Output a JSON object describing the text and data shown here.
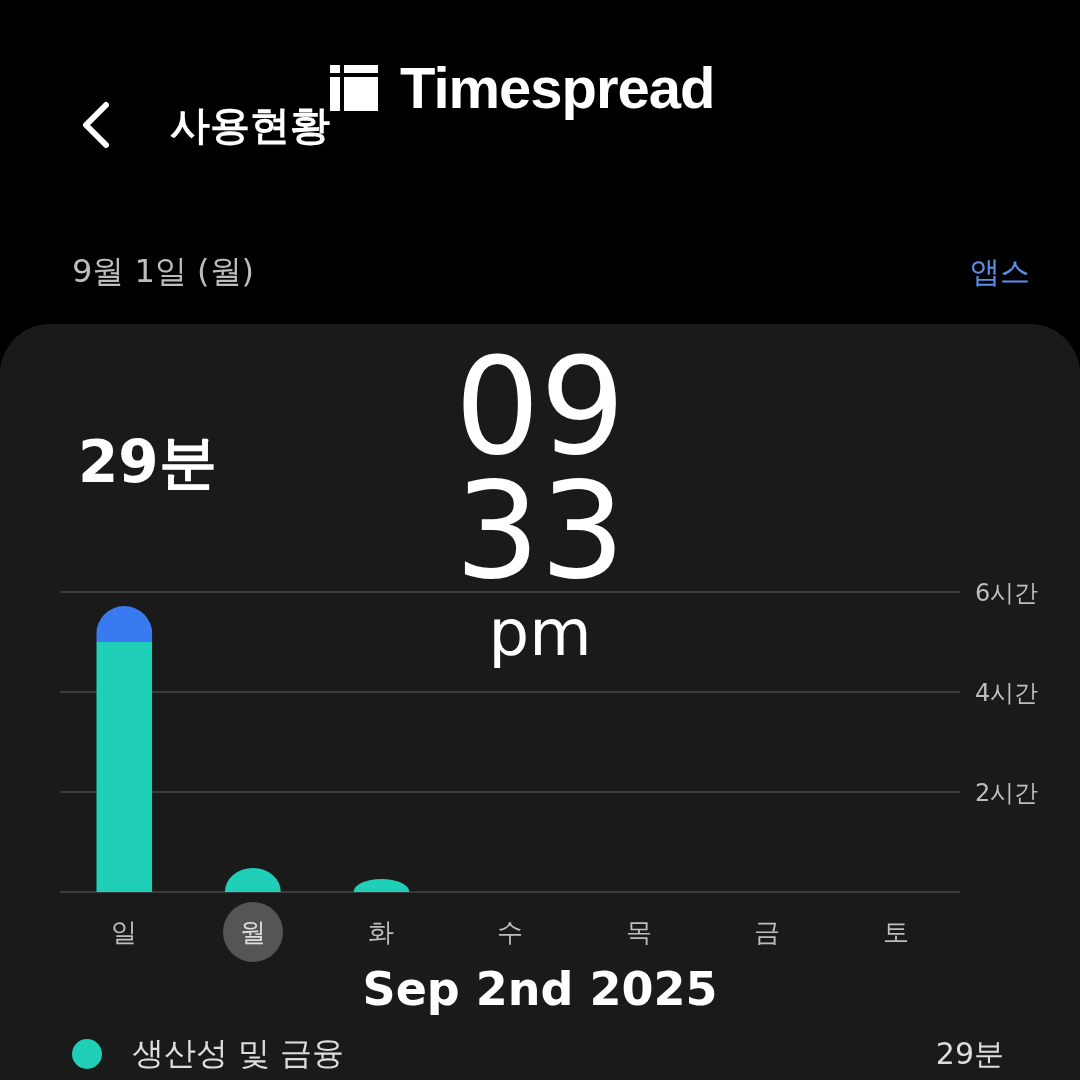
{
  "header": {
    "title": "사용현황"
  },
  "date_row": {
    "date": "9월 1일 (월)",
    "link": "앱스"
  },
  "card": {
    "total": "29분",
    "chart_data": {
      "type": "bar",
      "stacked": true,
      "grid": true,
      "categories": [
        "일",
        "월",
        "화",
        "수",
        "목",
        "금",
        "토"
      ],
      "ylim": [
        0,
        6
      ],
      "yticks": [
        {
          "value": 2,
          "label": "2시간"
        },
        {
          "value": 4,
          "label": "4시간"
        },
        {
          "value": 6,
          "label": "6시간"
        }
      ],
      "series": [
        {
          "name": "생산성 및 금융",
          "color": "#1fcfb8",
          "values": [
            5.0,
            0.48,
            0.26,
            0,
            0,
            0,
            0
          ]
        },
        {
          "color": "#3a7af0",
          "values": [
            0.72,
            0,
            0,
            0,
            0,
            0,
            0
          ]
        }
      ]
    },
    "days": [
      {
        "selected": false
      },
      {
        "selected": true
      },
      {
        "selected": false
      },
      {
        "selected": false
      },
      {
        "selected": false
      },
      {
        "selected": false
      },
      {
        "selected": false
      }
    ],
    "legend": [
      {
        "value": "29분"
      }
    ]
  },
  "overlay": {
    "brand": "Timespread",
    "hour": "09",
    "minute": "33",
    "ampm": "pm",
    "date": "Sep 2nd 2025"
  }
}
